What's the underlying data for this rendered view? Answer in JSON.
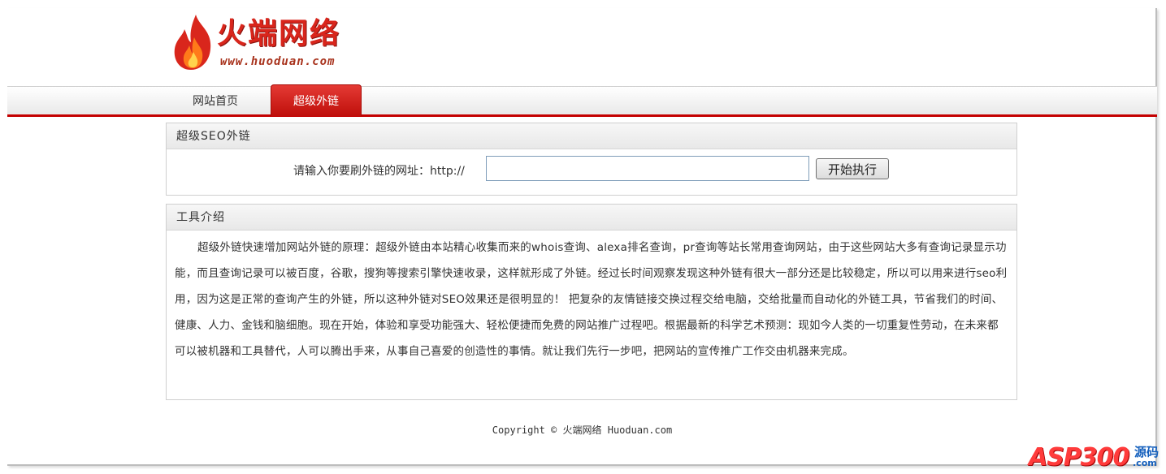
{
  "brand": {
    "title": "火端网络",
    "url": "www.huoduan.com",
    "accent_color": "#d9261c"
  },
  "nav": {
    "items": [
      {
        "label": "网站首页",
        "active": false
      },
      {
        "label": "超级外链",
        "active": true
      }
    ]
  },
  "seo_panel": {
    "title": "超级SEO外链",
    "label": "请输入你要刷外链的网址：http://",
    "input_value": "",
    "button_label": "开始执行"
  },
  "intro_panel": {
    "title": "工具介绍",
    "body": "超级外链快速增加网站外链的原理：超级外链由本站精心收集而来的whois查询、alexa排名查询，pr查询等站长常用查询网站，由于这些网站大多有查询记录显示功能，而且查询记录可以被百度，谷歌，搜狗等搜索引擎快速收录，这样就形成了外链。经过长时间观察发现这种外链有很大一部分还是比较稳定，所以可以用来进行seo利用，因为这是正常的查询产生的外链，所以这种外链对SEO效果还是很明显的！ 把复杂的友情链接交换过程交给电脑，交给批量而自动化的外链工具，节省我们的时间、健康、人力、金钱和脑细胞。现在开始，体验和享受功能强大、轻松便捷而免费的网站推广过程吧。根据最新的科学艺术预测：现如今人类的一切重复性劳动，在未来都可以被机器和工具替代，人可以腾出手来，从事自己喜爱的创造性的事情。就让我们先行一步吧，把网站的宣传推广工作交由机器来完成。"
  },
  "footer": {
    "copyright": "Copyright © 火端网络 Huoduan.com"
  },
  "watermark": {
    "text": "ASP300",
    "sub1": "源码",
    "sub2": ".com"
  }
}
